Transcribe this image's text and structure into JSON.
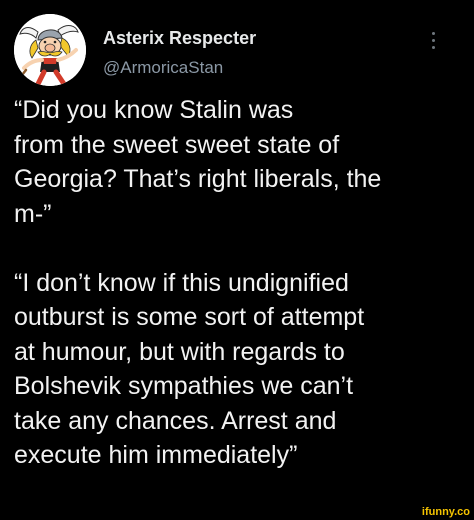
{
  "author": {
    "display_name": "Asterix Respecter",
    "handle": "@ArmoricaStan",
    "avatar_icon": "asterix-cartoon-avatar"
  },
  "menu": {
    "icon": "more-vertical-icon"
  },
  "tweet": {
    "paragraph_1": [
      "“Did you know Stalin was",
      "from the sweet sweet state of",
      "Georgia? That’s right liberals, the",
      "m-”"
    ],
    "paragraph_2": [
      "“I don’t know if this undignified",
      "outburst is some sort of attempt",
      "at humour, but with regards to",
      "Bolshevik sympathies we can’t",
      "take any chances. Arrest and",
      "execute him immediately”"
    ]
  },
  "watermark": {
    "text": "ifunny.co",
    "color": "#f5c400"
  },
  "colors": {
    "background": "#000000",
    "primary_text": "#e7e9ea",
    "secondary_text": "#8b98a5"
  }
}
